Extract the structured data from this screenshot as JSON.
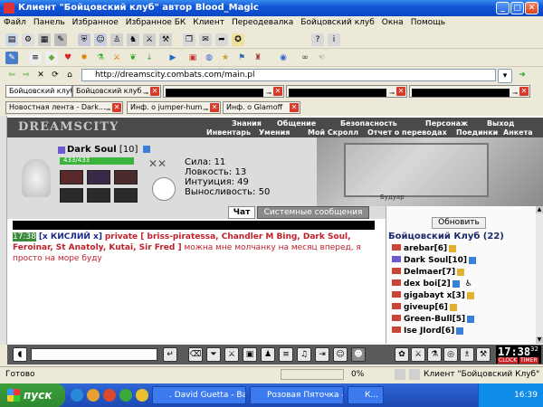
{
  "window": {
    "title": "Клиент \"Бойцовский клуб\" автор Blood_Magic"
  },
  "menu": [
    "Файл",
    "Панель",
    "Избранное",
    "Избранное БК",
    "Клиент",
    "Переодевалка",
    "Бойцовский клуб",
    "Окна",
    "Помощь"
  ],
  "address": {
    "url": "http://dreamscity.combats.com/main.pl"
  },
  "tabs_row1": [
    {
      "label": "Бойцовский клуб",
      "active": true
    },
    {
      "label": "Бойцовский клуб",
      "active": false
    }
  ],
  "tabs_row2": [
    {
      "label": "Новостная лента - Dark..."
    },
    {
      "label": "Инф. о jumper-hum"
    },
    {
      "label": "Инф. о Glamoff"
    }
  ],
  "game": {
    "logo": "DREAMSCITY",
    "nav_top": [
      "Знания",
      "Общение",
      "Безопасность",
      "Персонаж",
      "Выход"
    ],
    "nav_bottom": [
      "Инвентарь",
      "Умения",
      "Мой Скролл",
      "Отчет о переводах",
      "Поединки",
      "Анкета"
    ],
    "character": {
      "name": "Dark Soul",
      "level": "[10]",
      "hp": "433/433",
      "stats": [
        {
          "label": "Сила:",
          "value": "11"
        },
        {
          "label": "Ловкость:",
          "value": "13"
        },
        {
          "label": "Интуиция:",
          "value": "49"
        },
        {
          "label": "Выносливость:",
          "value": "50"
        }
      ],
      "hp_fraction": 1.0
    },
    "scene_label": "Будуар"
  },
  "chat": {
    "tabs": [
      "Чат",
      "Системные сообщения"
    ],
    "message": {
      "time": "17:38",
      "sender": "[x КИСЛИЙ x]",
      "private_label": "private [ briss-piratessa, Chandler M Bing, Dark Soul, Feroinar, St Anatoly, Kutai, Sir Fred ]",
      "text": "можна мне молчанку на месяц вперед, я просто на море буду"
    }
  },
  "online": {
    "refresh_label": "Обновить",
    "room_title": "Бойцовский Клуб (22)",
    "users": [
      {
        "name": "arebar",
        "level": "[6]"
      },
      {
        "name": "Dark Soul",
        "level": "[10]"
      },
      {
        "name": "Delmaer",
        "level": "[7]"
      },
      {
        "name": "dex boi",
        "level": "[2]"
      },
      {
        "name": "gigabayt x",
        "level": "[3]"
      },
      {
        "name": "giveup",
        "level": "[6]"
      },
      {
        "name": "Green-Bull",
        "level": "[5]"
      },
      {
        "name": "Ise JIord",
        "level": "[6]"
      }
    ]
  },
  "bottom": {
    "time": "17:38",
    "seconds": "32",
    "clock_label": "CLOCK",
    "timer_label": "TIMER"
  },
  "status": {
    "left": "Готово",
    "percent": "0%",
    "right": "Клиент \"Бойцовский Клуб\""
  },
  "taskbar": {
    "start_label": "пуск",
    "buttons": [
      ". David Guetta - Ba...",
      "Розовая Пяточка - ...",
      "К..."
    ],
    "clock": "16:39"
  }
}
